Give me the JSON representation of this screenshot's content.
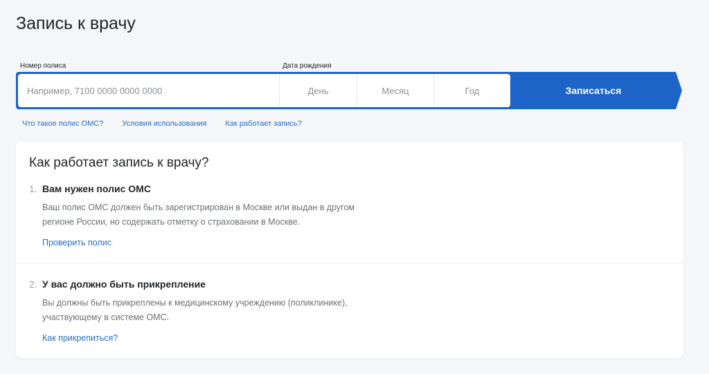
{
  "page_title": "Запись к врачу",
  "form": {
    "policy_label": "Номер полиса",
    "policy_placeholder": "Например, 7100 0000 0000 0000",
    "birth_label": "Дата рождения",
    "day": "День",
    "month": "Месяц",
    "year": "Год",
    "submit": "Записаться"
  },
  "links": [
    "Что такое полис ОМС?",
    "Условия использования",
    "Как работает запись?"
  ],
  "card": {
    "title": "Как работает запись к врачу?",
    "steps": [
      {
        "num": "1.",
        "heading": "Вам нужен полис ОМС",
        "line1": "Ваш полис ОМС должен быть зарегистрирован в Москве или выдан в другом",
        "line2": "регионе России, но содержать отметку о страховании в Москве.",
        "link": "Проверить полис"
      },
      {
        "num": "2.",
        "heading": "У вас должно быть прикрепление",
        "line1": "Вы должны быть прикреплены к медицинскому учреждению (поликлинике),",
        "line2": "участвующему в системе ОМС.",
        "link": "Как прикрепиться?"
      }
    ]
  },
  "colors": {
    "accent": "#1c64c8",
    "link": "#2a6dc3"
  }
}
